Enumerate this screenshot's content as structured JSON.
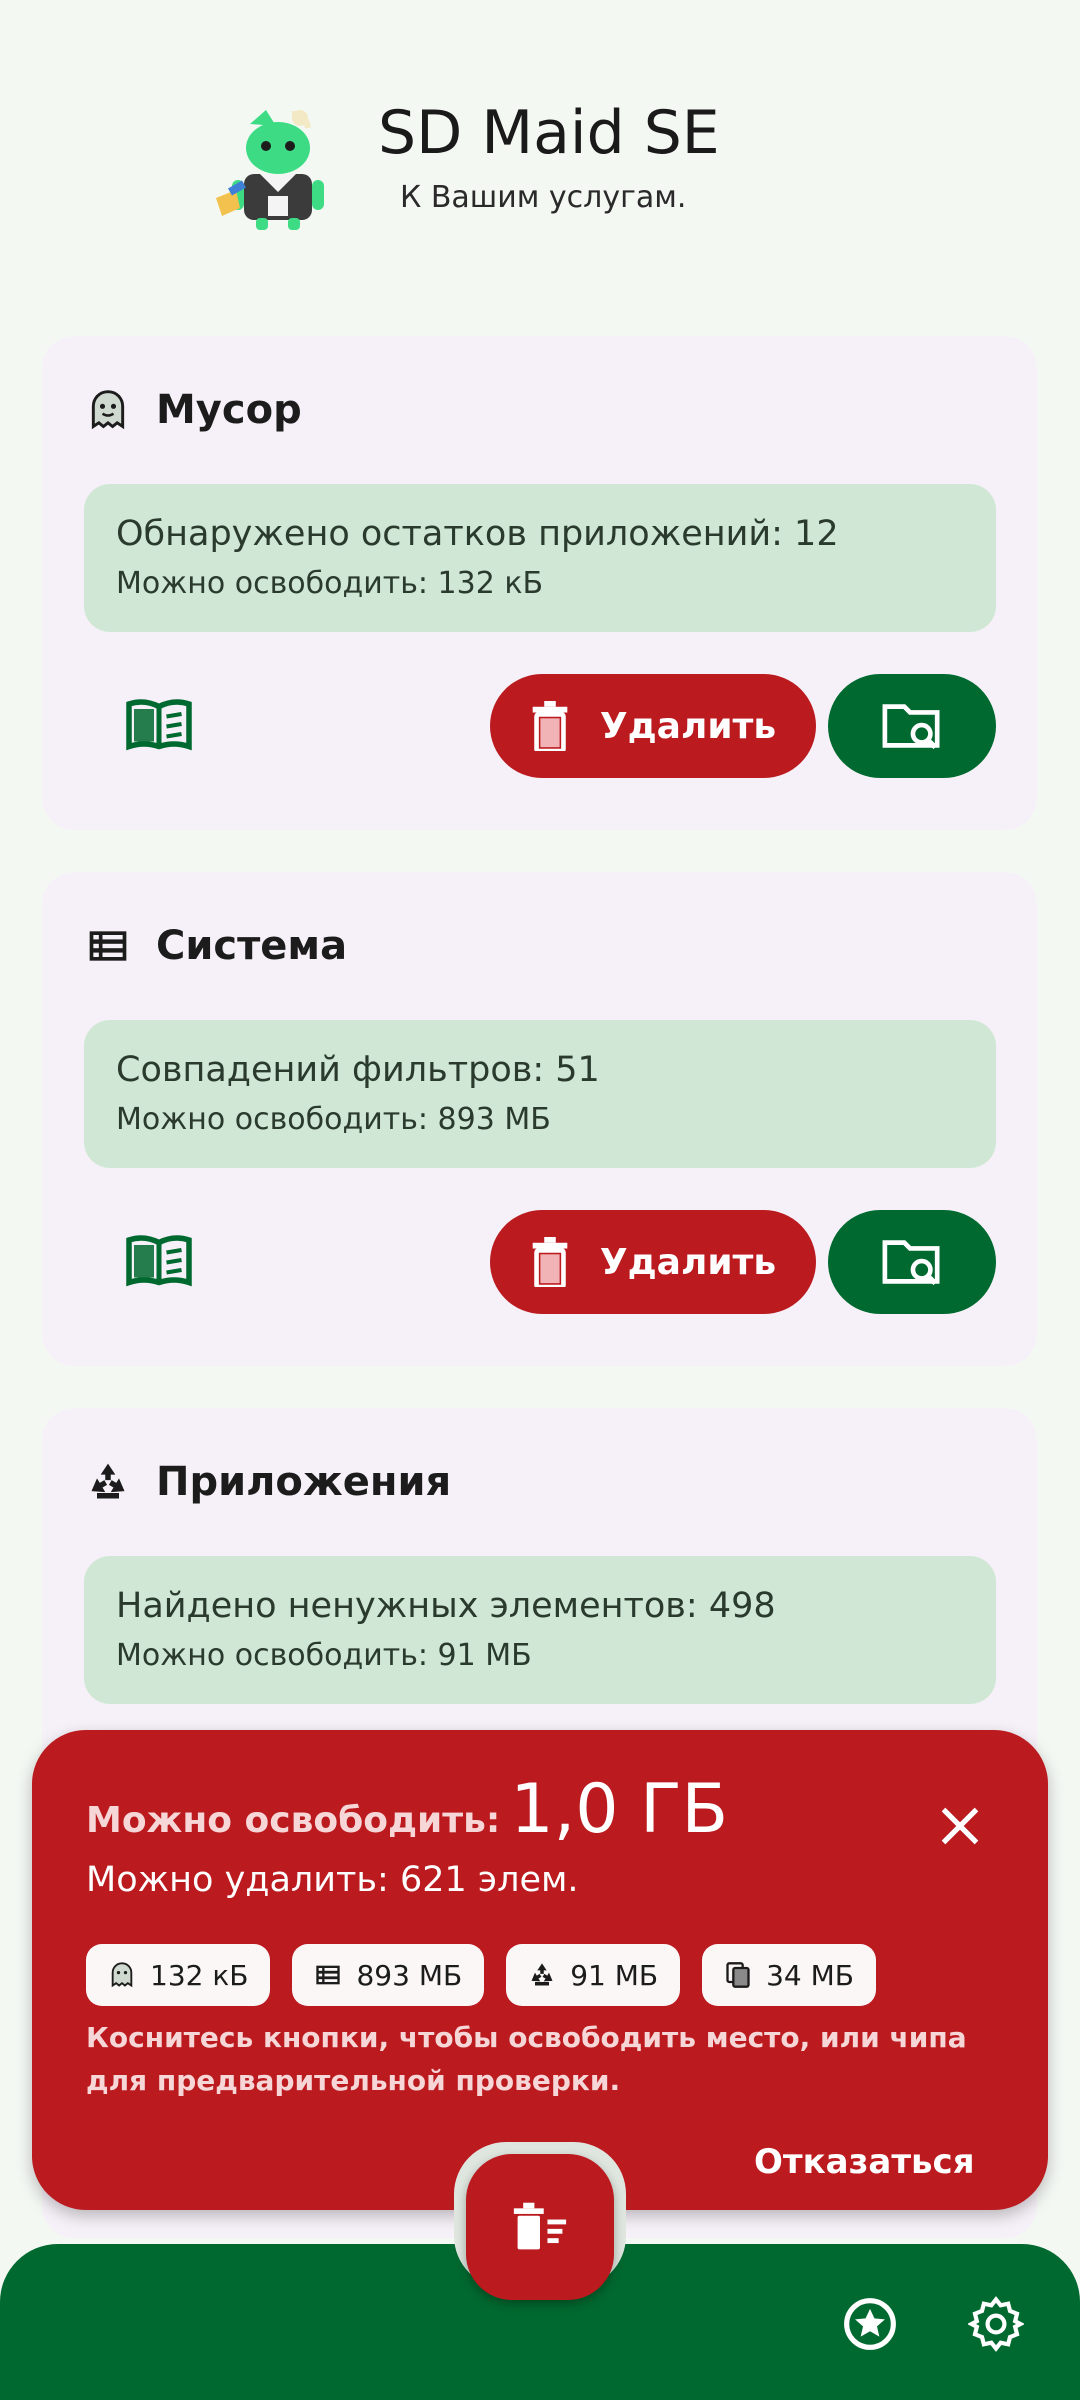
{
  "header": {
    "app_title": "SD Maid SE",
    "subtitle": "К Вашим услугам."
  },
  "cards": [
    {
      "title": "Мусор",
      "icon": "ghost-icon",
      "info_main": "Обнаружено остатков приложений: 12",
      "info_sub": "Можно освободить: 132 кБ",
      "delete_label": "Удалить"
    },
    {
      "title": "Система",
      "icon": "list-icon",
      "info_main": "Совпадений фильтров: 51",
      "info_sub": "Можно освободить: 893 МБ",
      "delete_label": "Удалить"
    },
    {
      "title": "Приложения",
      "icon": "recycle-icon",
      "info_main": "Найдено ненужных элементов: 498",
      "info_sub": "Можно освободить: 91 МБ"
    }
  ],
  "sheet": {
    "free_label": "Можно освободить:",
    "free_size": "1,0 ГБ",
    "count": "Можно удалить: 621 элем.",
    "chips": [
      {
        "icon": "ghost-icon",
        "label": "132 кБ"
      },
      {
        "icon": "list-icon",
        "label": "893 МБ"
      },
      {
        "icon": "recycle-icon",
        "label": "91 МБ"
      },
      {
        "icon": "copy-icon",
        "label": "34 МБ"
      }
    ],
    "hint": "Коснитесь кнопки, чтобы освободить место, или чипа для предварительной проверки.",
    "cancel_label": "Отказаться"
  },
  "colors": {
    "accent_red": "#bb1a1f",
    "accent_green": "#00692f",
    "info_box": "#d0e7d5",
    "card_bg": "#f6f1f8",
    "page_bg": "#f4f8f3"
  }
}
